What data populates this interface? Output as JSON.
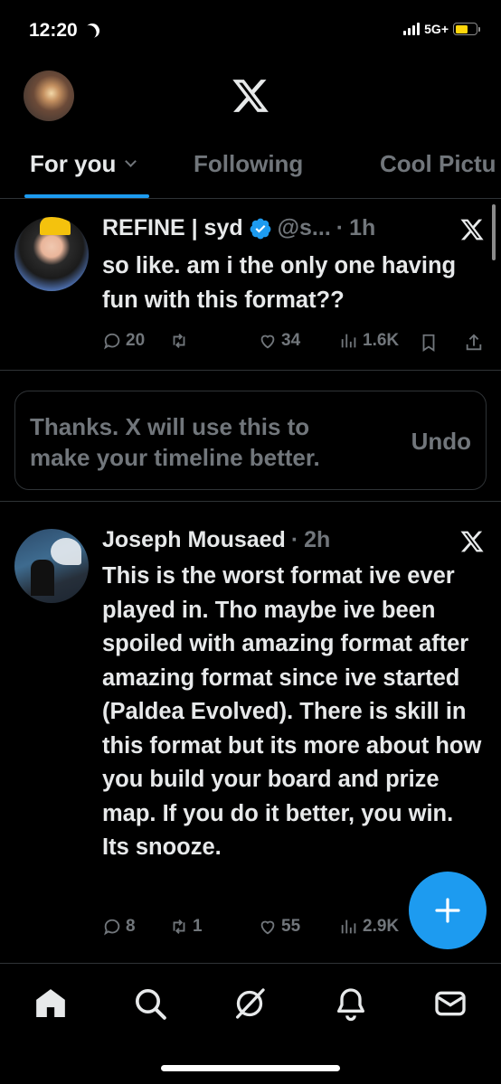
{
  "status_bar": {
    "time": "12:20",
    "network": "5G+"
  },
  "tabs": [
    {
      "label": "For you"
    },
    {
      "label": "Following"
    },
    {
      "label": "Cool Pictu"
    }
  ],
  "posts": [
    {
      "name": "REFINE | syd",
      "handle": "@s...",
      "separator": "·",
      "time": "1h",
      "text": "so like. am i the only one having fun with this format??",
      "replies": "20",
      "reposts": "",
      "likes": "34",
      "views": "1.6K"
    },
    {
      "name": "Joseph Mousaed",
      "separator": "·",
      "time": "2h",
      "text": "This is the worst format ive ever played in. Tho maybe ive been spoiled with amazing format after amazing format since ive started (Paldea Evolved). There is skill in this format but its more about how you build your board and prize map. If you do it better, you win. Its snooze.",
      "replies": "8",
      "reposts": "1",
      "likes": "55",
      "views": "2.9K"
    }
  ],
  "feedback": {
    "message": "Thanks. X will use this to make your timeline better.",
    "undo_label": "Undo"
  },
  "colors": {
    "accent": "#1d9bf0",
    "background": "#000000",
    "text_primary": "#e7e9ea",
    "text_secondary": "#71767b",
    "divider": "#2f3336",
    "battery": "#ffd60a"
  },
  "icons": {
    "nav": [
      "home-icon",
      "search-icon",
      "grok-icon",
      "notifications-icon",
      "messages-icon"
    ],
    "fab": "compose-plus-icon"
  }
}
